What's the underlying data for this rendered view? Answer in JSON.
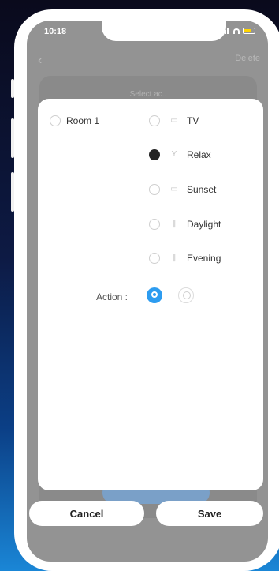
{
  "status_bar": {
    "time": "10:18"
  },
  "nav": {
    "back_icon": "chevron-left-icon",
    "delete_label": "Delete"
  },
  "background": {
    "card_title": "Select ac.."
  },
  "modal": {
    "room_label": "Room 1",
    "scenes": [
      {
        "label": "TV",
        "icon": "tv-icon",
        "selected": false
      },
      {
        "label": "Relax",
        "icon": "cocktail-icon",
        "selected": true
      },
      {
        "label": "Sunset",
        "icon": "sunset-icon",
        "selected": false
      },
      {
        "label": "Daylight",
        "icon": "daylight-icon",
        "selected": false
      },
      {
        "label": "Evening",
        "icon": "evening-icon",
        "selected": false
      }
    ],
    "action_label": "Action :",
    "action_options": [
      {
        "icon": "bulb-on-icon",
        "selected": true
      },
      {
        "icon": "bulb-off-icon",
        "selected": false
      }
    ]
  },
  "buttons": {
    "cancel": "Cancel",
    "save": "Save"
  },
  "colors": {
    "accent": "#2d9cf0",
    "overlay": "#939393",
    "selected_radio": "#222222"
  }
}
